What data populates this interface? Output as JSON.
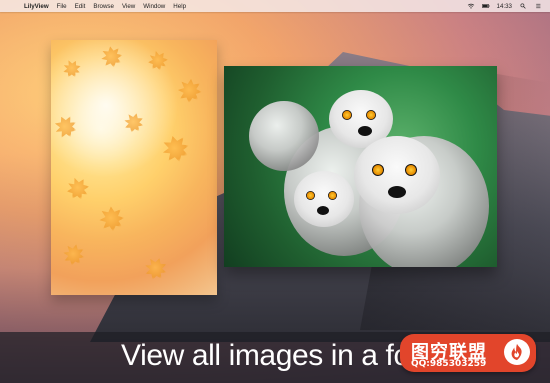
{
  "menubar": {
    "apple_icon": "apple-icon",
    "app_name": "LilyView",
    "items": [
      "File",
      "Edit",
      "Browse",
      "View",
      "Window",
      "Help"
    ],
    "time": "14:33"
  },
  "windows": {
    "autumn": {
      "image": "autumn-leaves"
    },
    "lemur": {
      "image": "ring-tailed-lemurs"
    }
  },
  "caption": "View all images in a folder",
  "watermark": {
    "title": "图穷联盟",
    "qq": "QQ:985303259",
    "icon": "flame-logo-icon"
  },
  "colors": {
    "accent_badge": "#e2452b"
  }
}
